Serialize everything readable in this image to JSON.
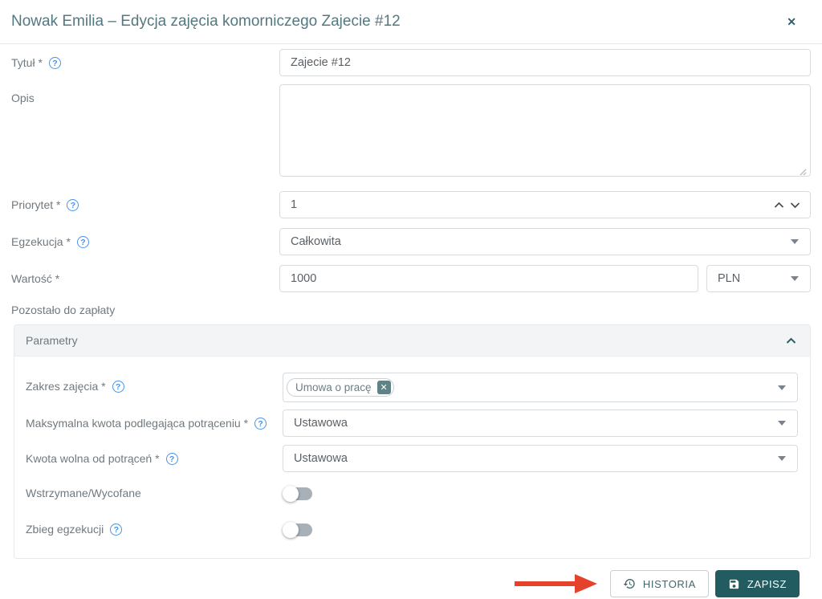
{
  "header": {
    "title": "Nowak Emilia – Edycja zajęcia komorniczego Zajecie #12"
  },
  "icons": {
    "close": "✕",
    "help": "?",
    "chip_remove": "✕"
  },
  "fields": {
    "tytul": {
      "label": "Tytuł *",
      "value": "Zajecie #12",
      "required": true
    },
    "opis": {
      "label": "Opis",
      "value": ""
    },
    "priorytet": {
      "label": "Priorytet *",
      "value": "1",
      "required": true
    },
    "egzekucja": {
      "label": "Egzekucja *",
      "value": "Całkowita",
      "required": true
    },
    "wartosc": {
      "label": "Wartość *",
      "value": "1000",
      "currency": "PLN",
      "required": true
    },
    "pozostalo": {
      "label": "Pozostało do zapłaty"
    }
  },
  "parameters_panel": {
    "title": "Parametry",
    "collapsed": false,
    "zakres": {
      "label": "Zakres zajęcia *",
      "chip": "Umowa o pracę"
    },
    "maksymalna": {
      "label": "Maksymalna kwota podlegająca potrąceniu *",
      "value": "Ustawowa"
    },
    "kwota_wolna": {
      "label": "Kwota wolna od potrąceń *",
      "value": "Ustawowa"
    },
    "wstrzymane": {
      "label": "Wstrzymane/Wycofane",
      "enabled": false
    },
    "zbieg": {
      "label": "Zbieg egzekucji",
      "enabled": false
    }
  },
  "footer": {
    "history_label": "HISTORIA",
    "save_label": "ZAPISZ"
  },
  "colors": {
    "accent_teal": "#225c61",
    "title_teal": "#54787f",
    "help_blue": "#4a94e8",
    "annotation_red": "#e6412b",
    "toggle_track_gray": "#a8b0b8"
  }
}
